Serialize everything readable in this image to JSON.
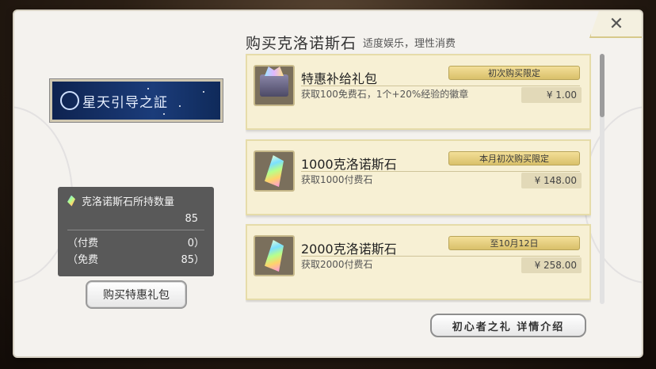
{
  "dialog": {
    "title": "购买克洛诺斯石",
    "subtitle": "适度娱乐，理性消费",
    "close_label": "✕"
  },
  "banner": {
    "text": "星天引导之証",
    "emblem_icon": "constellation-emblem-icon"
  },
  "stone_count": {
    "label": "克洛诺斯石所持数量",
    "total": "85",
    "paid_label": "（付费",
    "paid_value": "0）",
    "free_label": "（免费",
    "free_value": "85）"
  },
  "buy_gift_button": "购买特惠礼包",
  "details_button": "初心者之礼 详情介绍",
  "items": [
    {
      "name": "特惠补给礼包",
      "description": "获取100免费石，1个+20%经验的徽章",
      "limit": "初次购买限定",
      "price": "¥ 1.00",
      "icon": "treasure-chest-icon"
    },
    {
      "name": "1000克洛诺斯石",
      "description": "获取1000付费石",
      "limit": "本月初次购买限定",
      "price": "¥ 148.00",
      "icon": "chronos-stone-icon"
    },
    {
      "name": "2000克洛诺斯石",
      "description": "获取2000付费石",
      "limit": "至10月12日",
      "price": "¥ 258.00",
      "icon": "chronos-stone-icon"
    }
  ],
  "colors": {
    "panel": "#f4f2ee",
    "item_bg": "#f7f0d4",
    "badge": "#e4cd78",
    "count_box": "#595959"
  }
}
